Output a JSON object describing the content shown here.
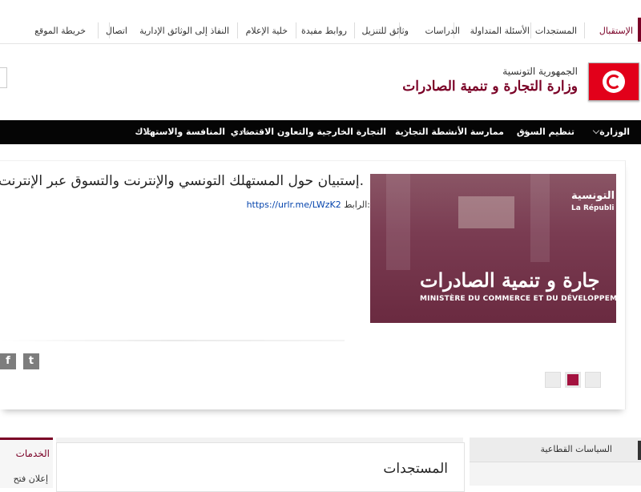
{
  "toplinks": {
    "items": [
      "الإستقبال",
      "المستجدات",
      "الأسئلة المتداولة",
      "الدراسات",
      "وثائق للتنزيل",
      "روابط مفيدة",
      "خلية الإعلام",
      "النفاذ إلى الوثائق الإدارية",
      "اتصال",
      "خريطة الموقع"
    ]
  },
  "header": {
    "republic": "الجمهورية التونسية",
    "ministry": "وزارة التجارة و تنمية الصادرات"
  },
  "nav": {
    "items": [
      "الوزارة",
      "تنظيم السوق",
      "ممارسة الأنشطة التجارية",
      "التجارة الخارجية والتعاون الاقتصادي",
      "المنافسة والاستهلاك"
    ]
  },
  "slide": {
    "headline": "إستبيان حول المستهلك التونسي والإنترنت والتسوق عبر الإنترنت.",
    "link_label": "الرابط:",
    "link_url": "https://urlr.me/LWzK2",
    "img_text1": "التونسية",
    "img_text2": "La Républi",
    "img_text3": "جارة و تنمية الصادرات",
    "img_text4": "MINISTÈRE DU COMMERCE ET DU DÉVELOPPEMENT"
  },
  "social": {
    "facebook": "f",
    "twitter": "t"
  },
  "bottom": {
    "services_title": "الخدمات",
    "services_item": "إعلان فتح",
    "news_title": "المستجدات",
    "policies_title": "السياسات القطاعية"
  },
  "colors": {
    "brand": "#7a0026",
    "navbar": "#050505",
    "flag": "#e2001a"
  }
}
